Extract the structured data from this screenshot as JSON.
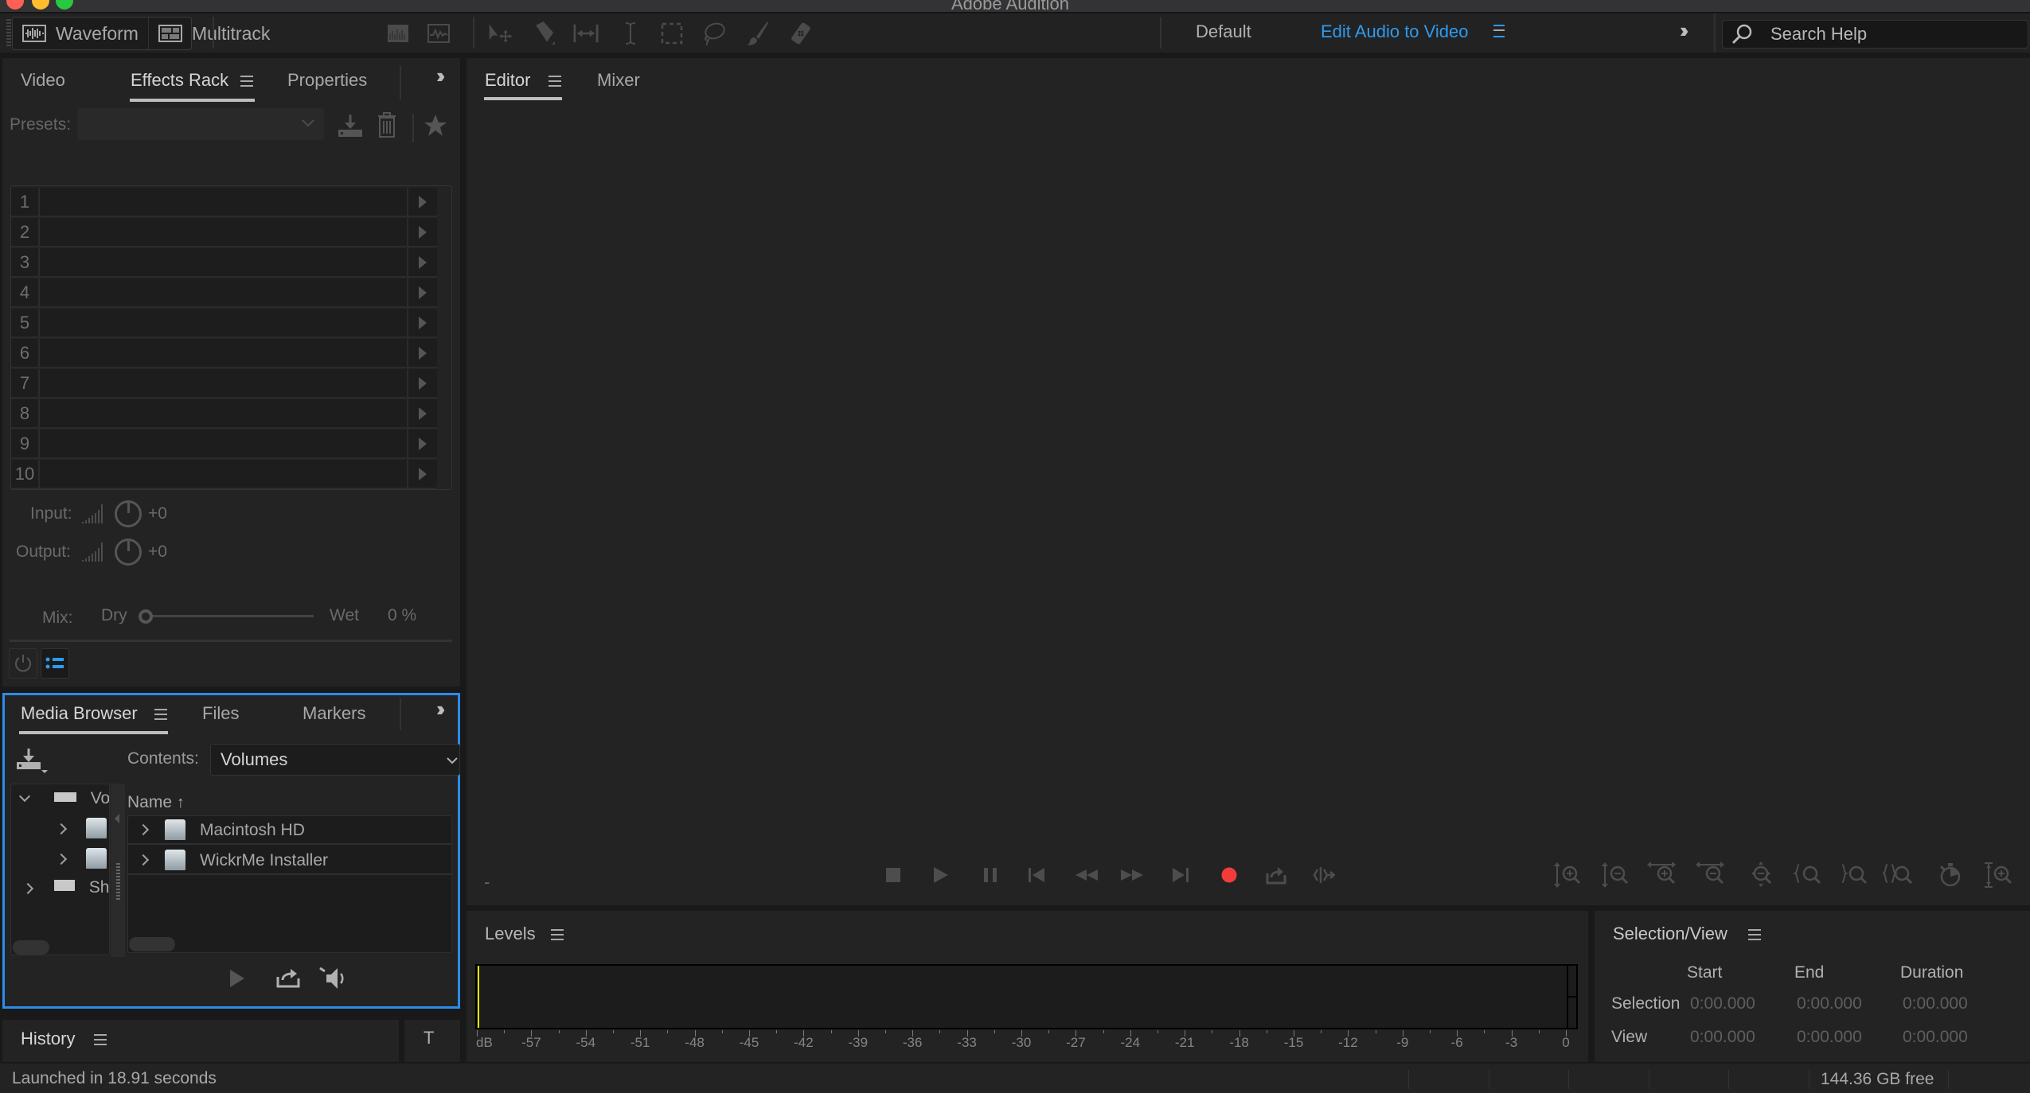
{
  "window": {
    "title": "Adobe Audition",
    "traffic_lights": {
      "close": "#fe5f57",
      "minimize": "#febc2e",
      "zoom": "#28c840"
    }
  },
  "toolbar": {
    "modes": [
      {
        "label": "Waveform",
        "icon": "waveform-icon"
      },
      {
        "label": "Multitrack",
        "icon": "multitrack-icon"
      }
    ],
    "view_tools": [
      "spectral-frequency-display-icon",
      "spectral-pitch-display-icon"
    ],
    "edit_tools": [
      "move-tool-icon",
      "razor-tool-icon",
      "slip-tool-icon",
      "time-selection-tool-icon",
      "marquee-selection-tool-icon",
      "lasso-selection-tool-icon",
      "brush-selection-tool-icon",
      "spot-healing-brush-icon"
    ],
    "workspaces": [
      {
        "label": "Default",
        "active": false
      },
      {
        "label": "Edit Audio to Video",
        "active": true
      }
    ],
    "accent_color": "#2d9bf0",
    "search_placeholder": "Search Help"
  },
  "left_panel": {
    "tabs": [
      {
        "label": "Video",
        "active": false
      },
      {
        "label": "Effects Rack",
        "active": true
      },
      {
        "label": "Properties",
        "active": false
      }
    ],
    "presets_label": "Presets:",
    "presets_value": "",
    "rack_slots": [
      "1",
      "2",
      "3",
      "4",
      "5",
      "6",
      "7",
      "8",
      "9",
      "10"
    ],
    "input_label": "Input:",
    "input_value": "+0",
    "output_label": "Output:",
    "output_value": "+0",
    "mix_label": "Mix:",
    "dry_label": "Dry",
    "wet_label": "Wet",
    "mix_percent_text": "0 %",
    "mix_percent": 0
  },
  "media_browser": {
    "tabs": [
      {
        "label": "Media Browser",
        "active": true
      },
      {
        "label": "Files",
        "active": false
      },
      {
        "label": "Markers",
        "active": false
      }
    ],
    "contents_label": "Contents:",
    "contents_value": "Volumes",
    "tree": [
      {
        "label": "Vol",
        "expanded": true,
        "level": 0
      },
      {
        "label": "",
        "expanded": false,
        "level": 1
      },
      {
        "label": "",
        "expanded": false,
        "level": 1
      },
      {
        "label": "Sho",
        "expanded": false,
        "level": 0
      }
    ],
    "column_header": "Name",
    "sort": "ascending",
    "items": [
      {
        "name": "Macintosh HD"
      },
      {
        "name": "WickrMe Installer"
      }
    ]
  },
  "history": {
    "tab_label": "History",
    "side_tab_label": "T"
  },
  "editor": {
    "tabs": [
      {
        "label": "Editor",
        "active": true
      },
      {
        "label": "Mixer",
        "active": false
      }
    ],
    "time_display": "-",
    "transport": [
      "stop-icon",
      "play-icon",
      "pause-icon",
      "go-to-start-icon",
      "rewind-icon",
      "fast-forward-icon",
      "go-to-end-icon",
      "record-icon",
      "loop-icon",
      "skip-selection-icon"
    ],
    "record_color": "#f23c3c",
    "zoom_tools": [
      "zoom-in-amplitude-icon",
      "zoom-out-amplitude-icon",
      "zoom-in-time-icon",
      "zoom-out-time-icon",
      "zoom-out-full-icon",
      "zoom-to-selection-in-icon",
      "zoom-to-selection-out-icon",
      "zoom-selection-icon",
      "zoom-to-time-icon",
      "zoom-in-all-tracks-icon"
    ]
  },
  "levels": {
    "title": "Levels",
    "unit": "dB",
    "ticks": [
      "-57",
      "-54",
      "-51",
      "-48",
      "-45",
      "-42",
      "-39",
      "-36",
      "-33",
      "-30",
      "-27",
      "-24",
      "-21",
      "-18",
      "-15",
      "-12",
      "-9",
      "-6",
      "-3",
      "0"
    ],
    "range_db": [
      -60,
      0
    ],
    "peak_color": "#e6e600"
  },
  "selection_view": {
    "title": "Selection/View",
    "columns": [
      "Start",
      "End",
      "Duration"
    ],
    "rows": [
      {
        "label": "Selection",
        "values": [
          "0:00.000",
          "0:00.000",
          "0:00.000"
        ]
      },
      {
        "label": "View",
        "values": [
          "0:00.000",
          "0:00.000",
          "0:00.000"
        ]
      }
    ]
  },
  "status_bar": {
    "message": "Launched in 18.91 seconds",
    "disk_free": "144.36 GB free"
  }
}
